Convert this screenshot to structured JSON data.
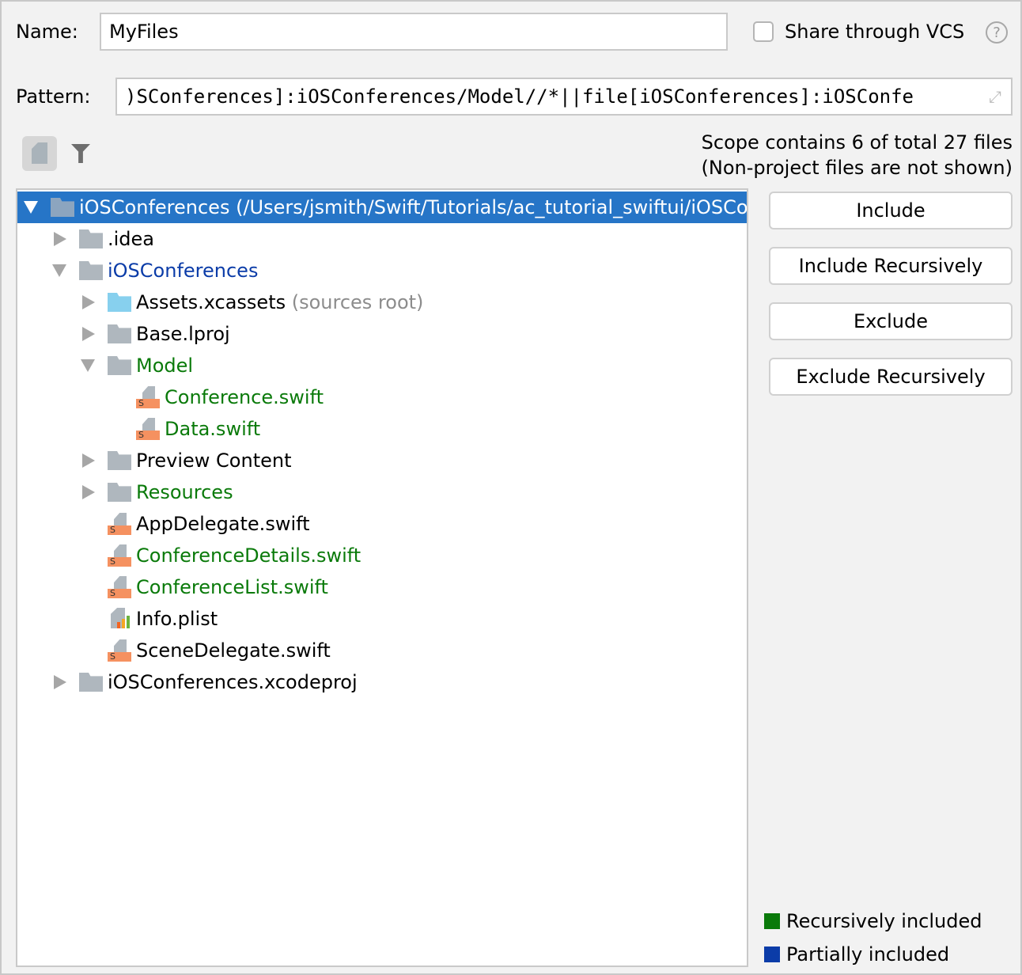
{
  "name": {
    "label": "Name:",
    "value": "MyFiles"
  },
  "share": {
    "label": "Share through VCS",
    "checked": false,
    "help": "?"
  },
  "pattern": {
    "label": "Pattern:",
    "value": ")SConferences]:iOSConferences/Model//*||file[iOSConferences]:iOSConfe"
  },
  "scope": {
    "line1": "Scope contains 6 of total 27 files",
    "line2": "(Non-project files are not shown)"
  },
  "tree": [
    {
      "level": 0,
      "expander": "open",
      "icon": "folder",
      "text": "iOSConferences (/Users/jsmith/Swift/Tutorials/ac_tutorial_swiftui/iOSConferences)",
      "color": "#ffffff",
      "selected": true
    },
    {
      "level": 1,
      "expander": "closed",
      "icon": "folder",
      "text": ".idea",
      "color": "#000000"
    },
    {
      "level": 1,
      "expander": "open",
      "icon": "folder",
      "text": "iOSConferences",
      "color": "#0b3ca8"
    },
    {
      "level": 2,
      "expander": "closed",
      "icon": "source-folder",
      "text": "Assets.xcassets",
      "suffix": "(sources root)",
      "color": "#000000"
    },
    {
      "level": 2,
      "expander": "closed",
      "icon": "folder",
      "text": "Base.lproj",
      "color": "#000000"
    },
    {
      "level": 2,
      "expander": "open",
      "icon": "folder",
      "text": "Model",
      "color": "#0a7a0a"
    },
    {
      "level": 3,
      "expander": "none",
      "icon": "swift",
      "text": "Conference.swift",
      "color": "#0a7a0a"
    },
    {
      "level": 3,
      "expander": "none",
      "icon": "swift",
      "text": "Data.swift",
      "color": "#0a7a0a"
    },
    {
      "level": 2,
      "expander": "closed",
      "icon": "folder",
      "text": "Preview Content",
      "color": "#000000"
    },
    {
      "level": 2,
      "expander": "closed",
      "icon": "folder",
      "text": "Resources",
      "color": "#0a7a0a"
    },
    {
      "level": 2,
      "expander": "none",
      "icon": "swift",
      "text": "AppDelegate.swift",
      "color": "#000000"
    },
    {
      "level": 2,
      "expander": "none",
      "icon": "swift",
      "text": "ConferenceDetails.swift",
      "color": "#0a7a0a"
    },
    {
      "level": 2,
      "expander": "none",
      "icon": "swift",
      "text": "ConferenceList.swift",
      "color": "#0a7a0a"
    },
    {
      "level": 2,
      "expander": "none",
      "icon": "plist",
      "text": "Info.plist",
      "color": "#000000"
    },
    {
      "level": 2,
      "expander": "none",
      "icon": "swift",
      "text": "SceneDelegate.swift",
      "color": "#000000"
    },
    {
      "level": 1,
      "expander": "closed",
      "icon": "folder",
      "text": "iOSConferences.xcodeproj",
      "color": "#000000"
    }
  ],
  "buttons": {
    "include": "Include",
    "include_rec": "Include Recursively",
    "exclude": "Exclude",
    "exclude_rec": "Exclude Recursively"
  },
  "legend": [
    {
      "label": "Recursively included",
      "color": "#0a7a0a"
    },
    {
      "label": "Partially included",
      "color": "#0b3ca8"
    }
  ],
  "swift_tag": "S"
}
